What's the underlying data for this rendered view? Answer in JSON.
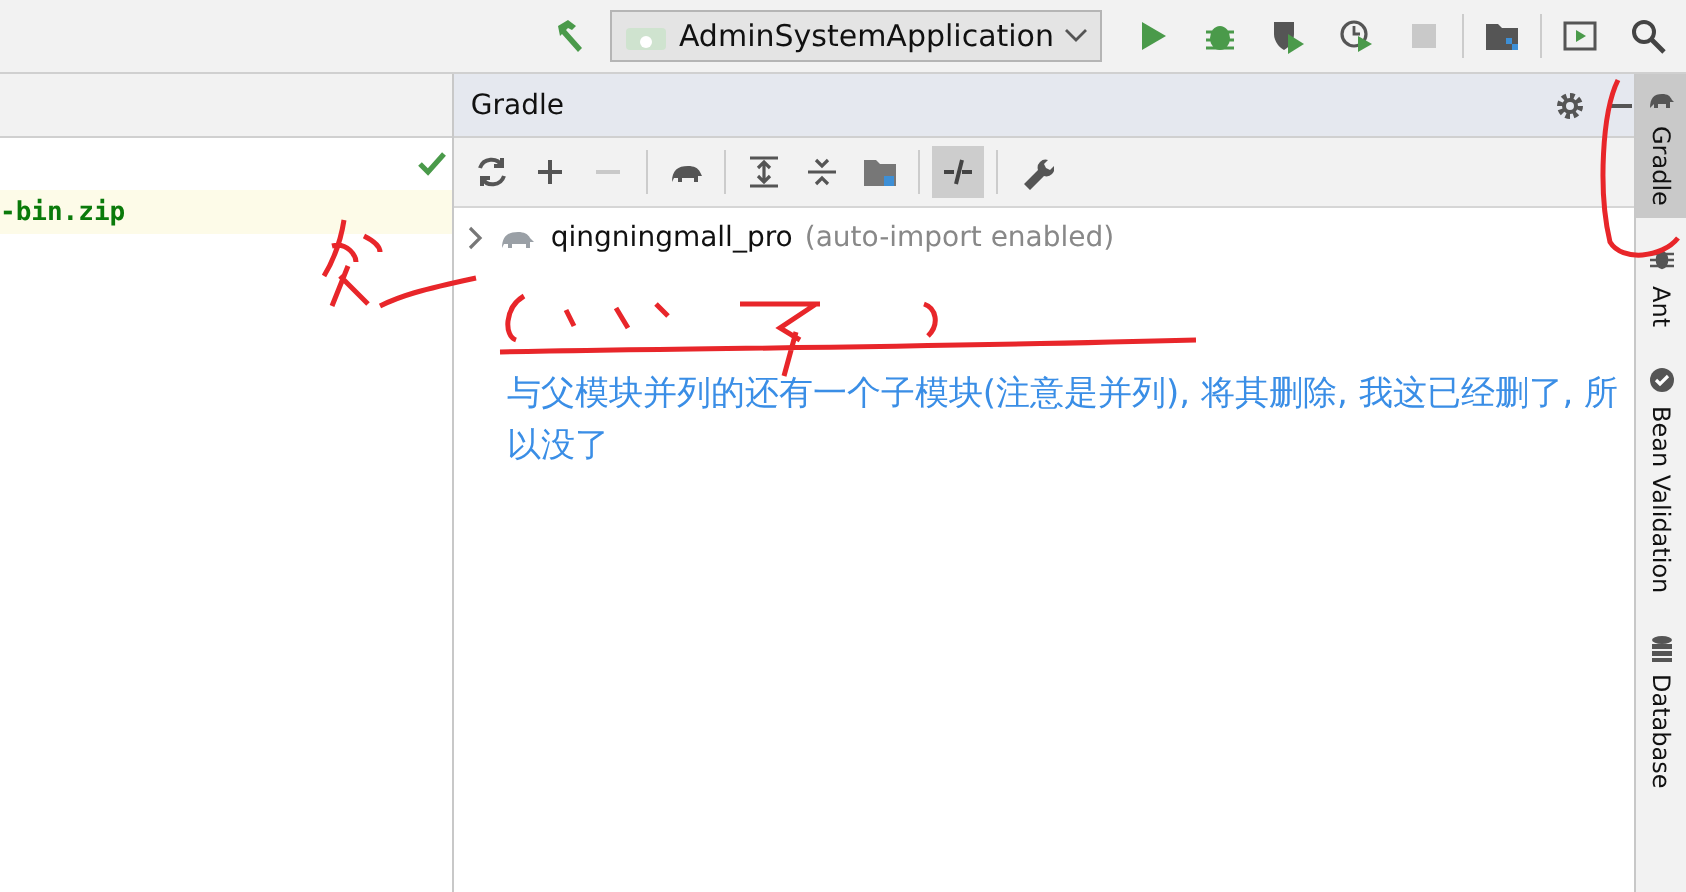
{
  "top_toolbar": {
    "run_config": "AdminSystemApplication",
    "tools": [
      {
        "kind": "hammer",
        "disabled": false
      },
      {
        "kind": "run",
        "disabled": false
      },
      {
        "kind": "debug",
        "disabled": false
      },
      {
        "kind": "coverage",
        "disabled": false
      },
      {
        "kind": "profile",
        "disabled": false
      },
      {
        "kind": "stop",
        "disabled": true
      },
      {
        "kind": "structure",
        "disabled": false
      },
      {
        "kind": "terminal",
        "disabled": false
      },
      {
        "kind": "search",
        "disabled": false
      }
    ]
  },
  "editor": {
    "line_text": "-bin.zip"
  },
  "gradle_panel": {
    "title": "Gradle",
    "tools": [
      {
        "kind": "refresh",
        "disabled": false,
        "selected": false
      },
      {
        "kind": "plus",
        "disabled": false,
        "selected": false
      },
      {
        "kind": "minus",
        "disabled": true,
        "selected": false
      },
      {
        "kind": "elephant",
        "disabled": false,
        "selected": false
      },
      {
        "kind": "expand",
        "disabled": false,
        "selected": false
      },
      {
        "kind": "collapse",
        "disabled": false,
        "selected": false
      },
      {
        "kind": "folder",
        "disabled": false,
        "selected": false
      },
      {
        "kind": "toggle",
        "disabled": false,
        "selected": true
      },
      {
        "kind": "wrench",
        "disabled": false,
        "selected": false
      }
    ],
    "tree": [
      {
        "name": "qingningmall_pro",
        "note": "(auto-import enabled)",
        "expanded": false
      }
    ]
  },
  "annotation": {
    "text": "与父模块并列的还有一个子模块(注意是并列), 将其删除, 我这已经删了, 所以没了"
  },
  "side_tabs": [
    {
      "label": "Gradle",
      "kind": "elephant",
      "selected": true
    },
    {
      "label": "Ant",
      "kind": "ant",
      "selected": false
    },
    {
      "label": "Bean Validation",
      "kind": "bean",
      "selected": false
    },
    {
      "label": "Database",
      "kind": "database",
      "selected": false
    }
  ]
}
